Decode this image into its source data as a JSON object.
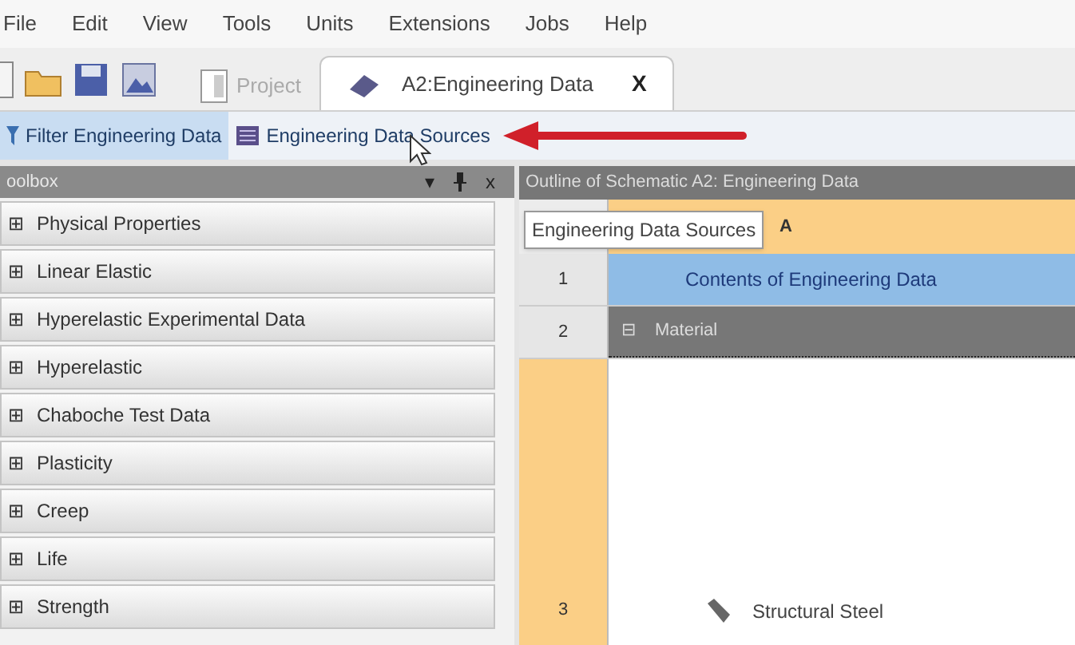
{
  "menu": [
    "File",
    "Edit",
    "View",
    "Tools",
    "Units",
    "Extensions",
    "Jobs",
    "Help"
  ],
  "tabs": [
    {
      "label": "Project",
      "selected": false,
      "closable": false
    },
    {
      "label": "A2:Engineering Data",
      "selected": true,
      "closable": true
    }
  ],
  "tab_close": "X",
  "toolbar": [
    {
      "label": "Filter Engineering Data",
      "kind": "filter",
      "selected": true
    },
    {
      "label": "Engineering Data Sources",
      "kind": "sources",
      "selected": false
    }
  ],
  "toolbox": {
    "title": "oolbox",
    "controls": [
      "▾",
      "x"
    ],
    "items": [
      {
        "label": "Physical Properties",
        "expander": "⊞"
      },
      {
        "label": "Linear Elastic",
        "expander": "⊞"
      },
      {
        "label": "Hyperelastic Experimental Data",
        "expander": "⊞"
      },
      {
        "label": "Hyperelastic",
        "expander": "⊞"
      },
      {
        "label": "Chaboche Test Data",
        "expander": "⊞"
      },
      {
        "label": "Plasticity",
        "expander": "⊞"
      },
      {
        "label": "Creep",
        "expander": "⊞"
      },
      {
        "label": "Life",
        "expander": "⊞"
      },
      {
        "label": "Strength",
        "expander": "⊞"
      }
    ]
  },
  "outline": {
    "title": "Outline of Schematic A2: Engineering Data",
    "column": "A",
    "rows": [
      {
        "number": "1",
        "kind": "heading",
        "text": "Contents of Engineering Data"
      },
      {
        "number": "2",
        "kind": "group",
        "expander": "⊟",
        "text": "Material"
      },
      {
        "number": "3",
        "kind": "material",
        "text": "Structural Steel"
      }
    ]
  },
  "tooltip": "Engineering Data Sources"
}
